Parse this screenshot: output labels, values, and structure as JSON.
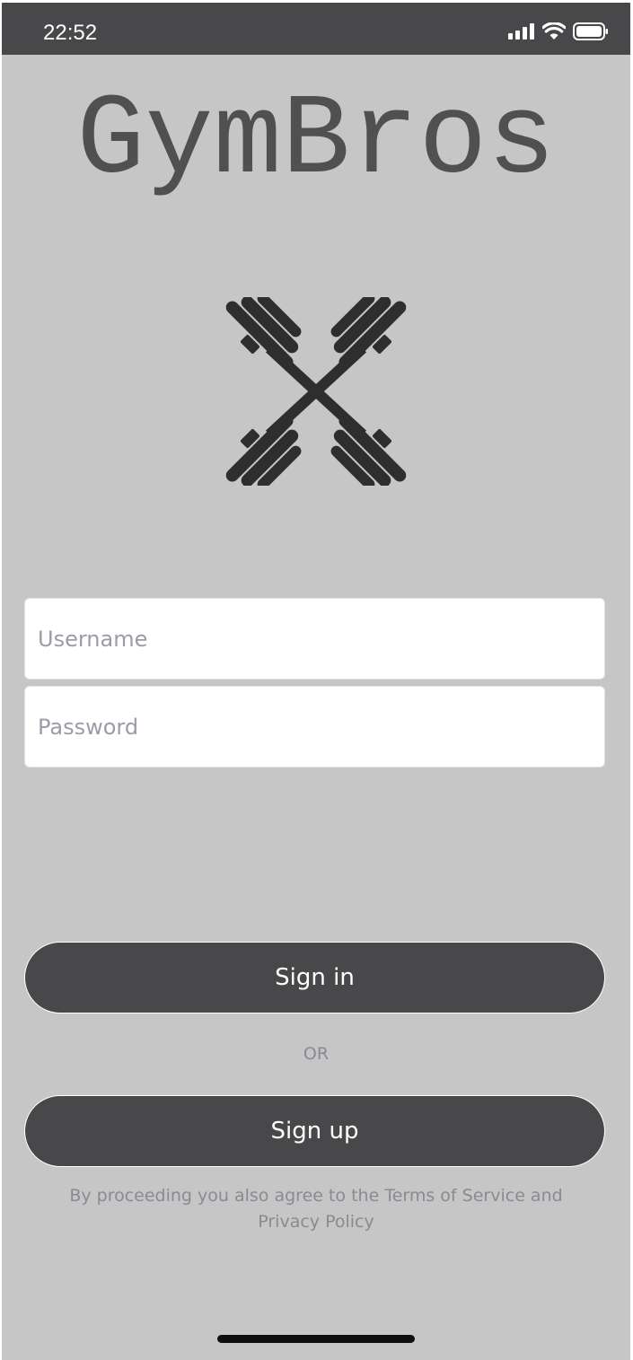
{
  "status_bar": {
    "time": "22:52",
    "icons": [
      "signal-icon",
      "wifi-icon",
      "battery-icon"
    ]
  },
  "app": {
    "title": "GymBros",
    "logo_icon": "crossed-dumbbells-icon"
  },
  "form": {
    "username_placeholder": "Username",
    "password_placeholder": "Password"
  },
  "actions": {
    "sign_in_label": "Sign in",
    "or_label": "OR",
    "sign_up_label": "Sign up"
  },
  "legal": {
    "terms_text": "By proceeding you also agree to the Terms of Service and Privacy Policy"
  },
  "colors": {
    "background": "#c6c6c6",
    "status_bar": "#48484a",
    "button": "#48484a",
    "muted_text": "#8a8a94",
    "title": "#505050"
  }
}
